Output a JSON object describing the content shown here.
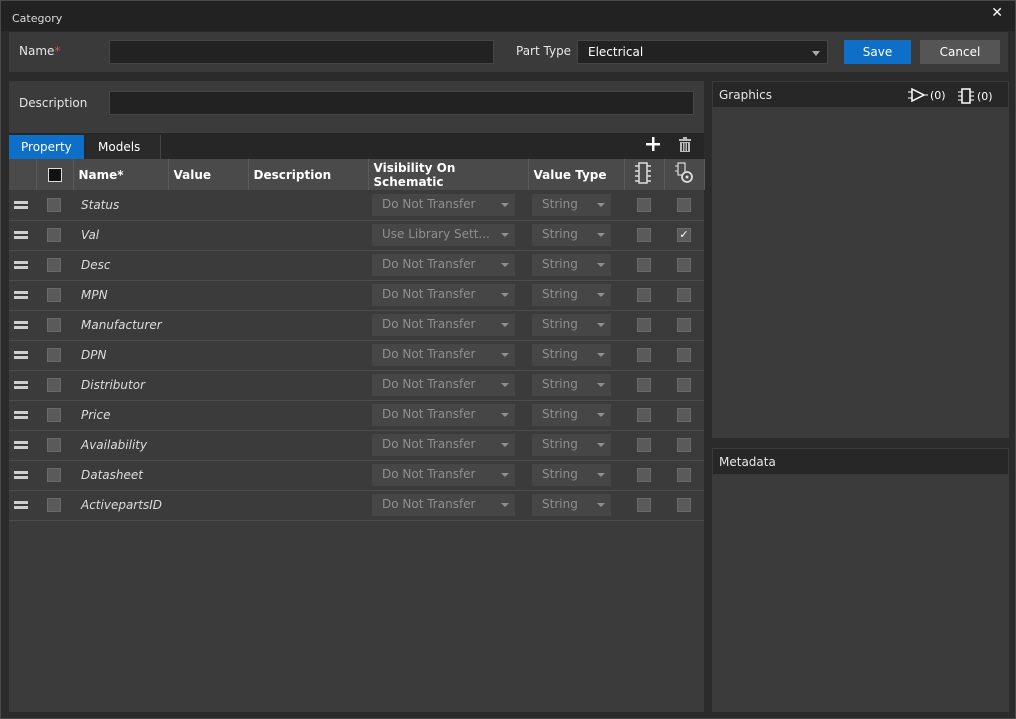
{
  "window": {
    "title": "Category",
    "close": "✕"
  },
  "form": {
    "name_label": "Name",
    "name_required": "*",
    "name_value": "",
    "part_type_label": "Part Type",
    "part_type_value": "Electrical",
    "save_label": "Save",
    "cancel_label": "Cancel",
    "description_label": "Description",
    "description_value": ""
  },
  "tabs": [
    {
      "label": "Property",
      "active": true
    },
    {
      "label": "Models",
      "active": false
    }
  ],
  "toolbar": {
    "add_icon": "plus-icon",
    "delete_icon": "trash-icon"
  },
  "columns": [
    "Name*",
    "Value",
    "Description",
    "Visibility On Schematic",
    "Value Type"
  ],
  "rows": [
    {
      "name": "Status",
      "visibility": "Do Not Transfer",
      "type": "String",
      "checked": false
    },
    {
      "name": "Val",
      "visibility": "Use Library Sett...",
      "type": "String",
      "checked": true
    },
    {
      "name": "Desc",
      "visibility": "Do Not Transfer",
      "type": "String",
      "checked": false
    },
    {
      "name": "MPN",
      "visibility": "Do Not Transfer",
      "type": "String",
      "checked": false
    },
    {
      "name": "Manufacturer",
      "visibility": "Do Not Transfer",
      "type": "String",
      "checked": false
    },
    {
      "name": "DPN",
      "visibility": "Do Not Transfer",
      "type": "String",
      "checked": false
    },
    {
      "name": "Distributor",
      "visibility": "Do Not Transfer",
      "type": "String",
      "checked": false
    },
    {
      "name": "Price",
      "visibility": "Do Not Transfer",
      "type": "String",
      "checked": false
    },
    {
      "name": "Availability",
      "visibility": "Do Not Transfer",
      "type": "String",
      "checked": false
    },
    {
      "name": "Datasheet",
      "visibility": "Do Not Transfer",
      "type": "String",
      "checked": false
    },
    {
      "name": "ActivepartsID",
      "visibility": "Do Not Transfer",
      "type": "String",
      "checked": false
    }
  ],
  "graphics": {
    "title": "Graphics",
    "symbol_count": "(0)",
    "footprint_count": "(0)"
  },
  "metadata": {
    "title": "Metadata"
  },
  "colors": {
    "accent": "#0e6fc9",
    "required": "#d9534f"
  }
}
